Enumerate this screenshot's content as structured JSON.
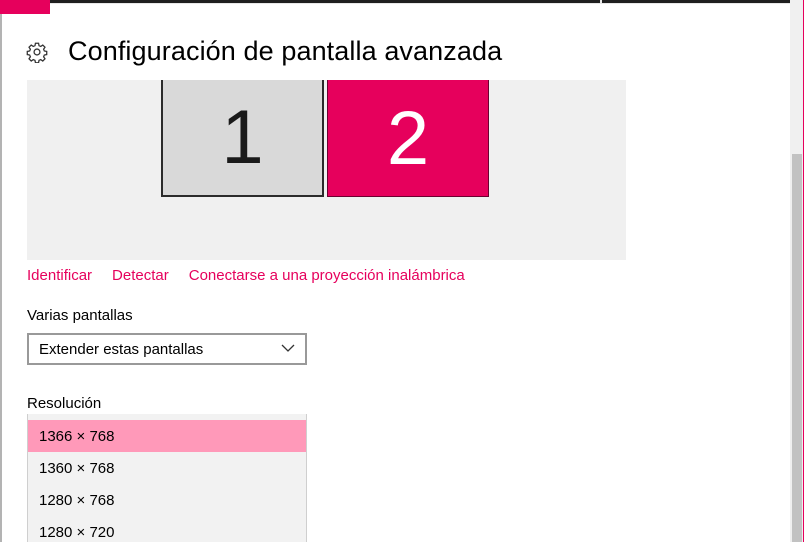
{
  "colors": {
    "accent": "#e6005c",
    "selected_bg": "#ff99b9"
  },
  "header": {
    "icon": "gear-icon",
    "title": "Configuración de pantalla avanzada"
  },
  "displays": [
    {
      "label": "1"
    },
    {
      "label": "2"
    }
  ],
  "links": {
    "identify": "Identificar",
    "detect": "Detectar",
    "wireless": "Conectarse a una proyección inalámbrica"
  },
  "multiple_displays": {
    "label": "Varias pantallas",
    "selected": "Extender estas pantallas"
  },
  "resolution": {
    "label": "Resolución",
    "options": [
      "1366 × 768",
      "1360 × 768",
      "1280 × 768",
      "1280 × 720"
    ],
    "selected_index": 0
  }
}
